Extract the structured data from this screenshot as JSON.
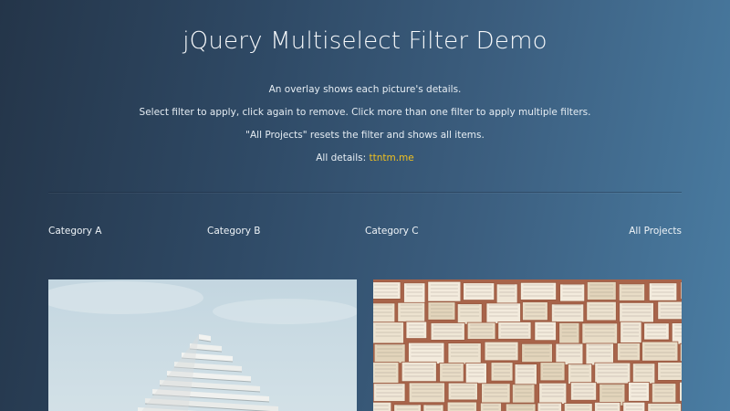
{
  "header": {
    "title": "jQuery Multiselect Filter Demo",
    "line1": "An overlay shows each picture's details.",
    "line2": "Select filter to apply, click again to remove. Click more than one filter to apply multiple filters.",
    "line3": "\"All Projects\" resets the filter and shows all items.",
    "details_prefix": "All details:",
    "details_link": "ttntm.me"
  },
  "filters": {
    "a": "Category A",
    "b": "Category B",
    "c": "Category C",
    "all": "All Projects"
  },
  "gallery": {
    "items": [
      "building-photo",
      "open-books-photo"
    ]
  },
  "colors": {
    "link": "#f0c020",
    "bg_start": "#243549",
    "bg_end": "#4a7da3"
  }
}
